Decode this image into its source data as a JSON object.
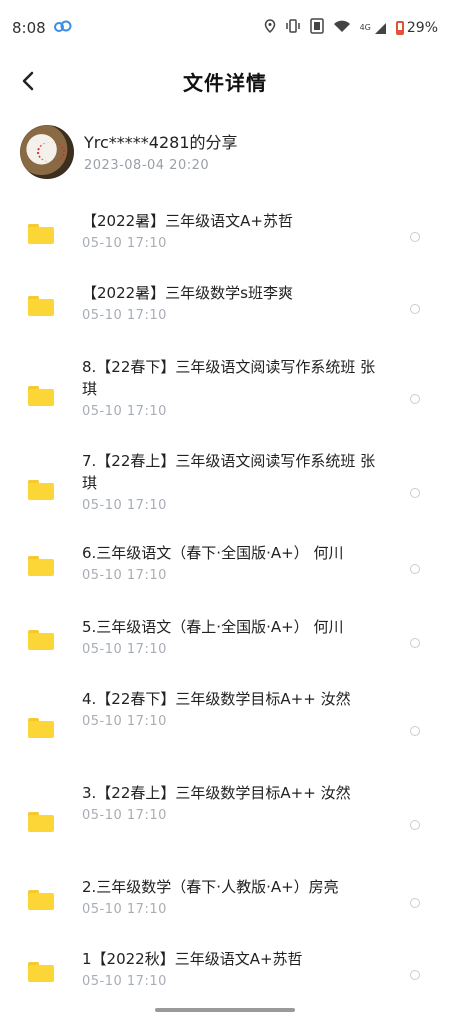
{
  "status_bar": {
    "time": "8:08",
    "network_badge": "4G",
    "battery": "29%",
    "battery_level": 0.29
  },
  "header": {
    "title": "文件详情"
  },
  "owner": {
    "name": "Yrc*****4281的分享",
    "time": "2023-08-04  20:20"
  },
  "files": [
    {
      "name": "【2022暑】三年级语文A+苏哲",
      "time": "05-10  17:10"
    },
    {
      "name": "【2022暑】三年级数学s班李爽",
      "time": "05-10  17:10"
    },
    {
      "name": "8.【22春下】三年级语文阅读写作系统班  张琪",
      "time": "05-10  17:10"
    },
    {
      "name": "7.【22春上】三年级语文阅读写作系统班  张琪",
      "time": "05-10  17:10"
    },
    {
      "name": "6.三年级语文（春下·全国版·A+） 何川",
      "time": "05-10  17:10"
    },
    {
      "name": "5.三年级语文（春上·全国版·A+） 何川",
      "time": "05-10  17:10"
    },
    {
      "name": "4.【22春下】三年级数学目标A++  汝然",
      "time": "05-10  17:10"
    },
    {
      "name": "3.【22春上】三年级数学目标A++  汝然",
      "time": "05-10  17:10"
    },
    {
      "name": "2.三年级数学（春下·人教版·A+）房亮",
      "time": "05-10  17:10"
    },
    {
      "name": "1【2022秋】三年级语文A+苏哲",
      "time": "05-10  17:10"
    }
  ]
}
